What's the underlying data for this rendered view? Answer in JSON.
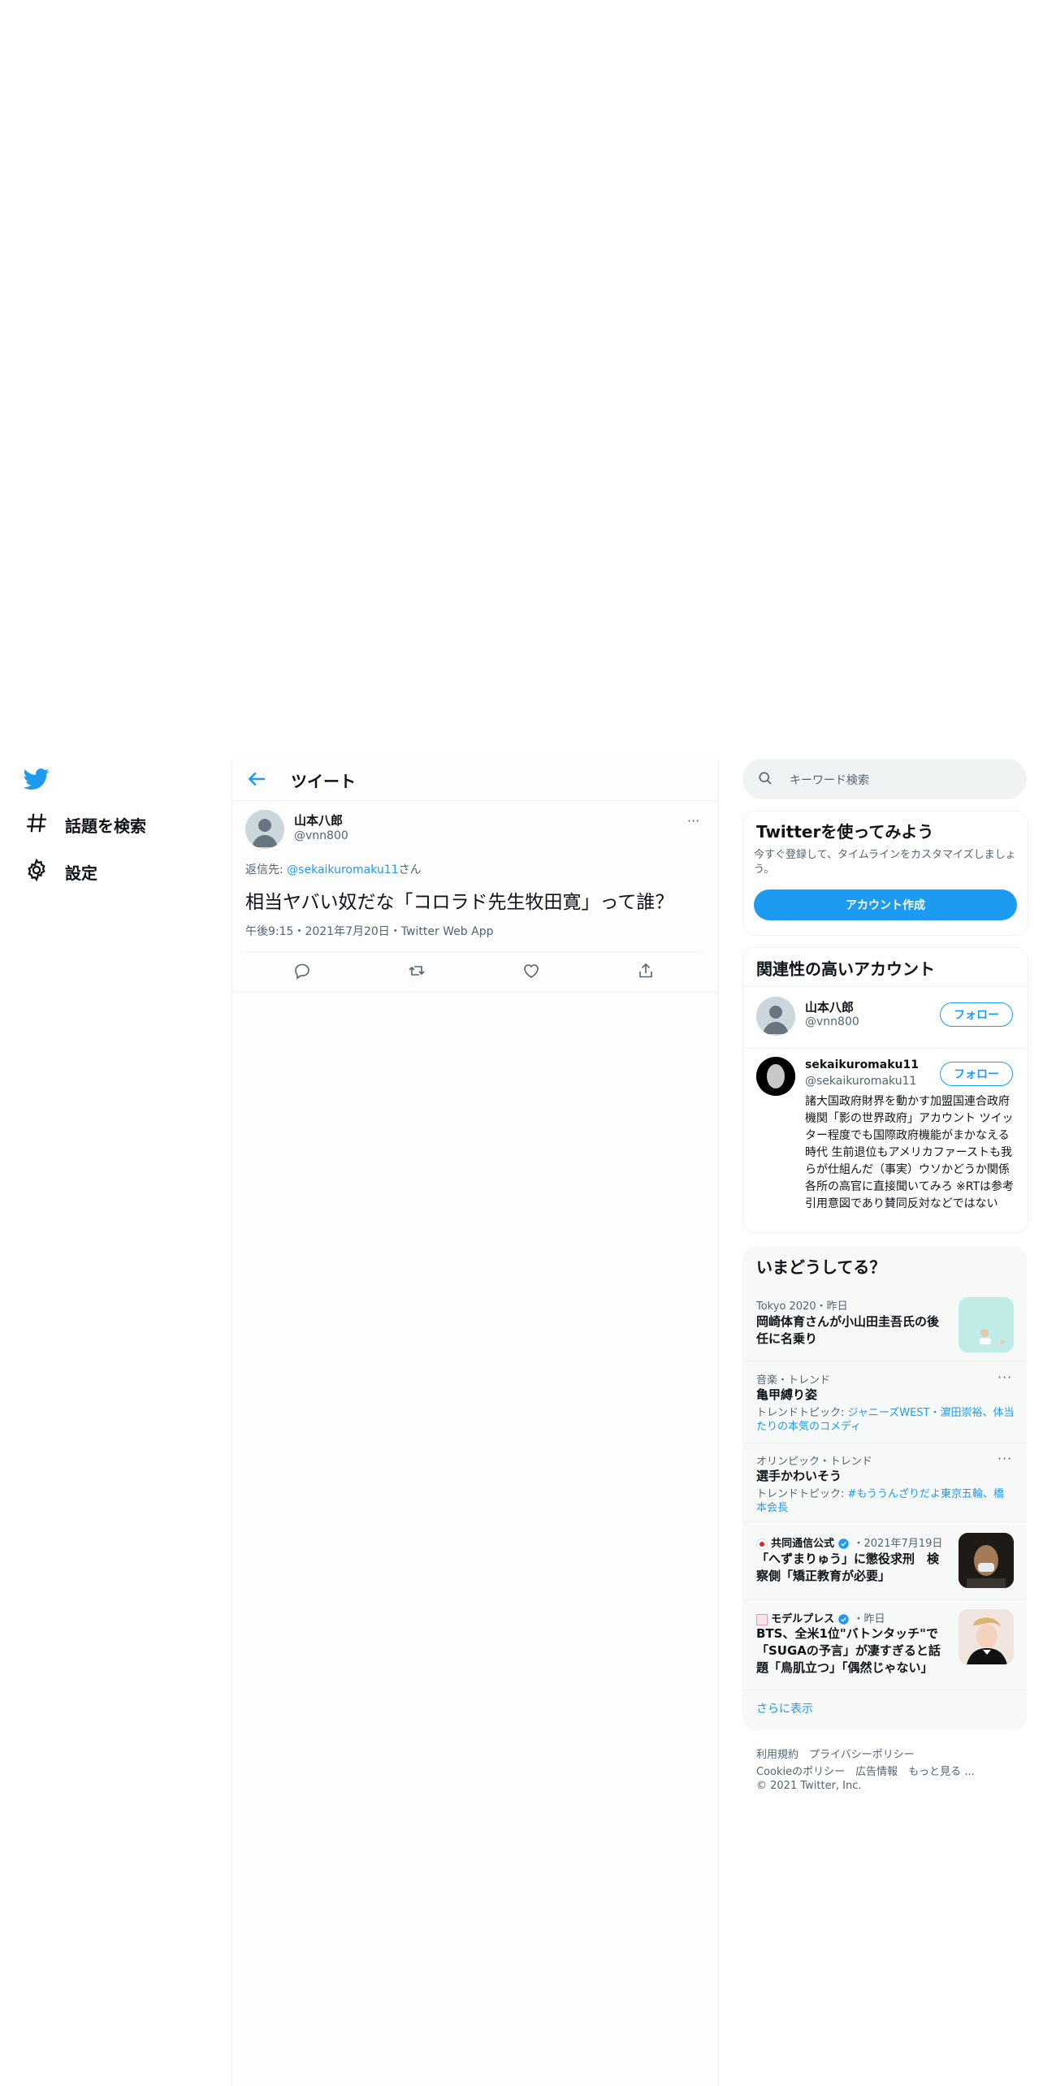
{
  "nav": {
    "explore_label": "話題を検索",
    "settings_label": "設定"
  },
  "header": {
    "title": "ツイート"
  },
  "tweet": {
    "author_name": "山本八郎",
    "author_handle": "@vnn800",
    "reply_prefix": "返信先: ",
    "reply_handle": "@sekaikuromaku11",
    "reply_suffix": "さん",
    "text": "相当ヤバい奴だな「コロラド先生牧田寛」って誰？",
    "meta": "午後9:15・2021年7月20日・Twitter Web App",
    "more": "···"
  },
  "search": {
    "placeholder": "キーワード検索"
  },
  "signup": {
    "title": "Twitterを使ってみよう",
    "desc": "今すぐ登録して、タイムラインをカスタマイズしましょう。",
    "button": "アカウント作成"
  },
  "related": {
    "title": "関連性の高いアカウント",
    "accounts": [
      {
        "name": "山本八郎",
        "handle": "@vnn800",
        "follow": "フォロー"
      },
      {
        "name": "sekaikuromaku11",
        "handle": "@sekaikuromaku11",
        "follow": "フォロー",
        "bio": "諸大国政府財界を動かす加盟国連合政府機関「影の世界政府」アカウント ツイッター程度でも国際政府機能がまかなえる時代 生前退位もアメリカファーストも我らが仕組んだ（事実）ウソかどうか関係各所の高官に直接聞いてみろ ※RTは参考引用意図であり賛同反対などではない"
      }
    ]
  },
  "trends": {
    "title": "いまどうしてる？",
    "items": [
      {
        "meta": "Tokyo 2020・昨日",
        "title": "岡崎体育さんが小山田圭吾氏の後任に名乗り"
      },
      {
        "meta": "音楽・トレンド",
        "title": "亀甲縛り姿",
        "sub_label": "トレンドトピック: ",
        "sub_link": "ジャニーズWEST・濵田崇裕、体当たりの本気のコメディ"
      },
      {
        "meta": "オリンピック・トレンド",
        "title": "選手かわいそう",
        "sub_label": "トレンドトピック: ",
        "sub_link": "#もううんざりだよ東京五輪、橋本会長"
      },
      {
        "source": "共同通信公式",
        "meta": "・2021年7月19日",
        "title": "「へずまりゅう」に懲役求刑　検察側「矯正教育が必要」"
      },
      {
        "source": "モデルプレス",
        "meta": "・昨日",
        "title": "BTS、全米1位\"バトンタッチ\"で「SUGAの予言」が凄すぎると話題「鳥肌立つ」「偶然じゃない」"
      }
    ],
    "show_more": "さらに表示",
    "dots": "···"
  },
  "footer": {
    "line1": "利用規約　プライバシーポリシー",
    "line2": "Cookieのポリシー　広告情報　もっと見る ...",
    "copyright": "© 2021 Twitter, Inc."
  },
  "colors": {
    "accent": "#1d9bf0",
    "text": "#0f1419",
    "secondary": "#536471"
  }
}
